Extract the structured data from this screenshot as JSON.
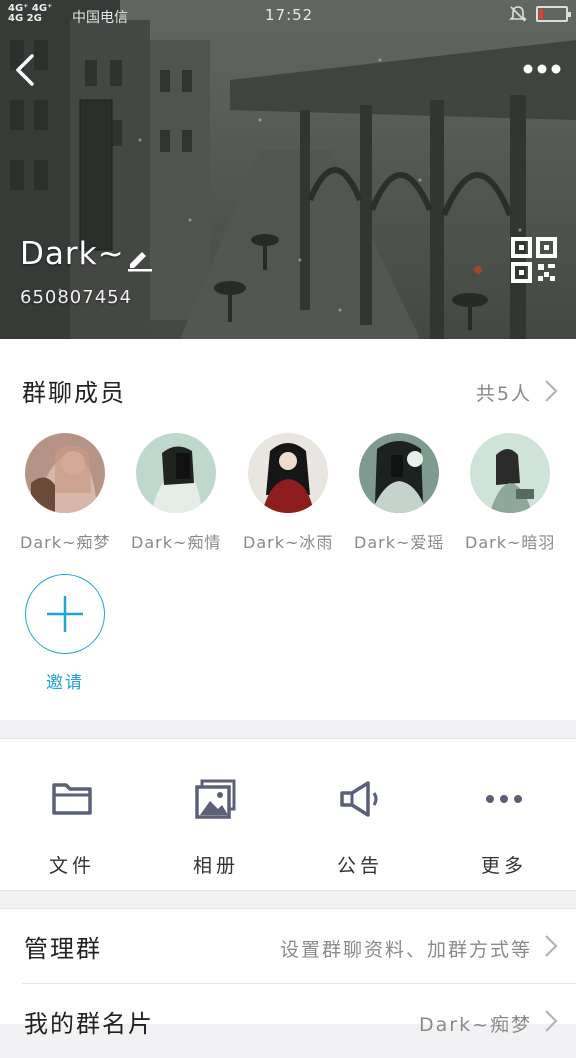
{
  "status_bar": {
    "signal_top": "4G⁺ 4G⁺",
    "signal_bottom": "4G 2G",
    "carrier": "中国电信",
    "time": "17:52",
    "battery_level": 0.15
  },
  "header": {
    "group_name": "Dark~",
    "group_id": "650807454"
  },
  "members": {
    "title": "群聊成员",
    "count_label": "共5人",
    "list": [
      {
        "name": "Dark~痴梦"
      },
      {
        "name": "Dark~痴情"
      },
      {
        "name": "Dark~冰雨"
      },
      {
        "name": "Dark~爱瑶"
      },
      {
        "name": "Dark~暗羽"
      }
    ],
    "invite_label": "邀请"
  },
  "actions": [
    {
      "label": "文件",
      "icon": "folder-icon"
    },
    {
      "label": "相册",
      "icon": "album-icon"
    },
    {
      "label": "公告",
      "icon": "megaphone-icon"
    },
    {
      "label": "更多",
      "icon": "more-dots-icon"
    }
  ],
  "rows": {
    "manage": {
      "title": "管理群",
      "value": "设置群聊资料、加群方式等"
    },
    "my_card": {
      "title": "我的群名片",
      "value": "Dark~痴梦"
    }
  },
  "colors": {
    "accent": "#1fa3db",
    "battery_low": "#e53b3b"
  }
}
